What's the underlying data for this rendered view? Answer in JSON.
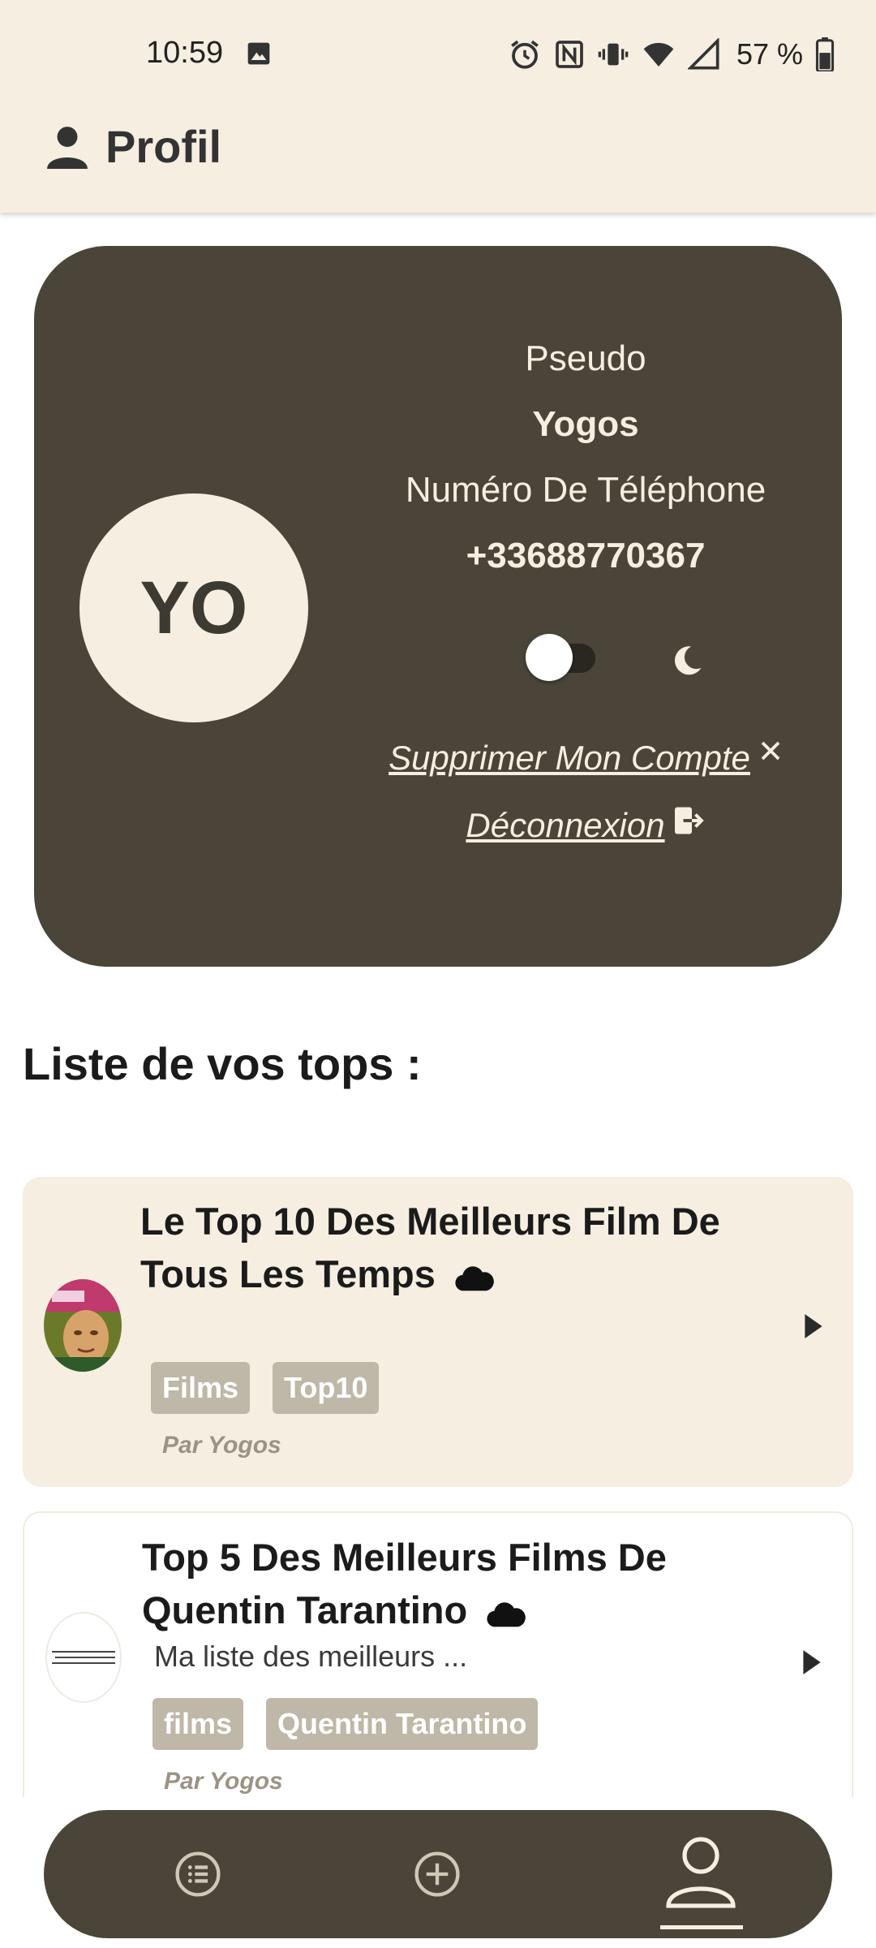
{
  "status_bar": {
    "time": "10:59",
    "battery": "57 %"
  },
  "header": {
    "title": "Profil"
  },
  "profile": {
    "avatar_initials": "YO",
    "pseudo_label": "Pseudo",
    "pseudo_value": "Yogos",
    "phone_label": "Numéro De Téléphone",
    "phone_value": "+33688770367",
    "dark_mode_enabled": false,
    "delete_account_label": "Supprimer Mon Compte",
    "logout_label": "Déconnexion"
  },
  "tops_section": {
    "title": "Liste de vos tops :",
    "items": [
      {
        "title": "Le Top 10 Des Meilleurs Film De Tous Les Temps",
        "description": "",
        "tags": [
          "Films",
          "Top10"
        ],
        "author": "Par Yogos",
        "thumbnail": "movie-poster"
      },
      {
        "title": "Top 5 Des Meilleurs Films De Quentin Tarantino",
        "description": "Ma liste des meilleurs ...",
        "tags": [
          "films",
          "Quentin Tarantino"
        ],
        "author": "Par Yogos",
        "thumbnail": "list-icon"
      }
    ]
  },
  "bottom_nav": {
    "items": [
      {
        "icon": "list-icon",
        "active": false
      },
      {
        "icon": "add-icon",
        "active": false
      },
      {
        "icon": "profile-icon",
        "active": true
      }
    ]
  },
  "colors": {
    "cream": "#f5eee1",
    "dark_olive": "#4a4538",
    "tag_bg": "#bfb7a7"
  }
}
